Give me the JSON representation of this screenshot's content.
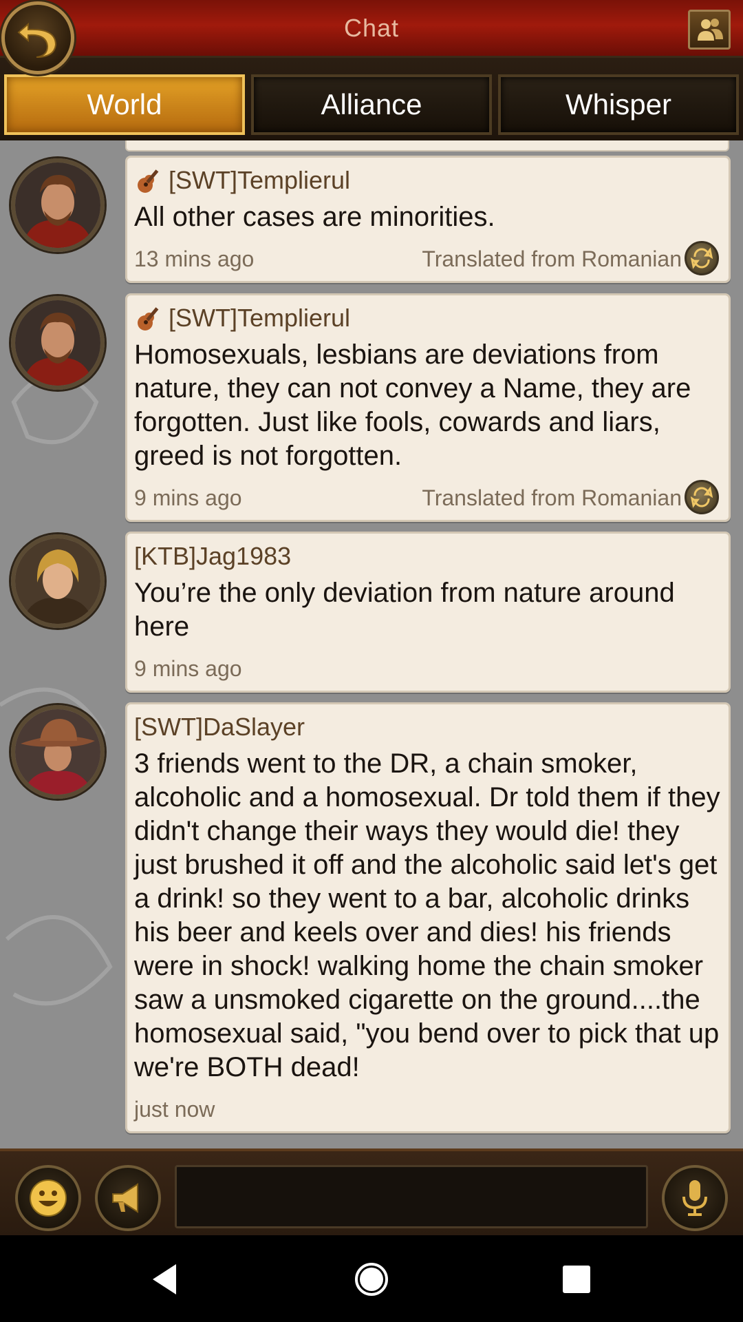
{
  "header": {
    "title": "Chat",
    "back_icon": "back-arrow-icon",
    "friends_icon": "friends-icon"
  },
  "tabs": [
    {
      "label": "World",
      "active": true
    },
    {
      "label": "Alliance",
      "active": false
    },
    {
      "label": "Whisper",
      "active": false
    }
  ],
  "messages": [
    {
      "sender": "[SWT]Templierul",
      "badge_icon": "guitar-icon",
      "text": "All other cases are minorities.",
      "time": "13 mins ago",
      "translated": "Translated from Romanian"
    },
    {
      "sender": "[SWT]Templierul",
      "badge_icon": "guitar-icon",
      "text": "Homosexuals, lesbians are deviations from nature, they can not convey a Name, they are forgotten. Just like fools, cowards and liars, greed is not forgotten.",
      "time": "9 mins ago",
      "translated": "Translated from Romanian"
    },
    {
      "sender": "[KTB]Jag1983",
      "text": "You’re the only deviation from nature around here",
      "time": "9 mins ago"
    },
    {
      "sender": "[SWT]DaSlayer",
      "text": "3 friends went to the DR, a chain smoker, alcoholic and a homosexual. Dr told them if they didn't change their ways they would die! they just brushed it off and the alcoholic said let's get a drink! so they went to a bar, alcoholic drinks his beer and keels over and dies! his friends were in shock! walking home the chain smoker saw a unsmoked cigarette on the ground....the homosexual said, \"you bend over to pick that up we're BOTH dead!",
      "time": "just now"
    }
  ],
  "input": {
    "value": ""
  },
  "colors": {
    "header_red": "#a01a0c",
    "tab_active": "#e3a126",
    "bubble_bg": "#f4ece0",
    "chat_bg": "#8e8e8e"
  }
}
